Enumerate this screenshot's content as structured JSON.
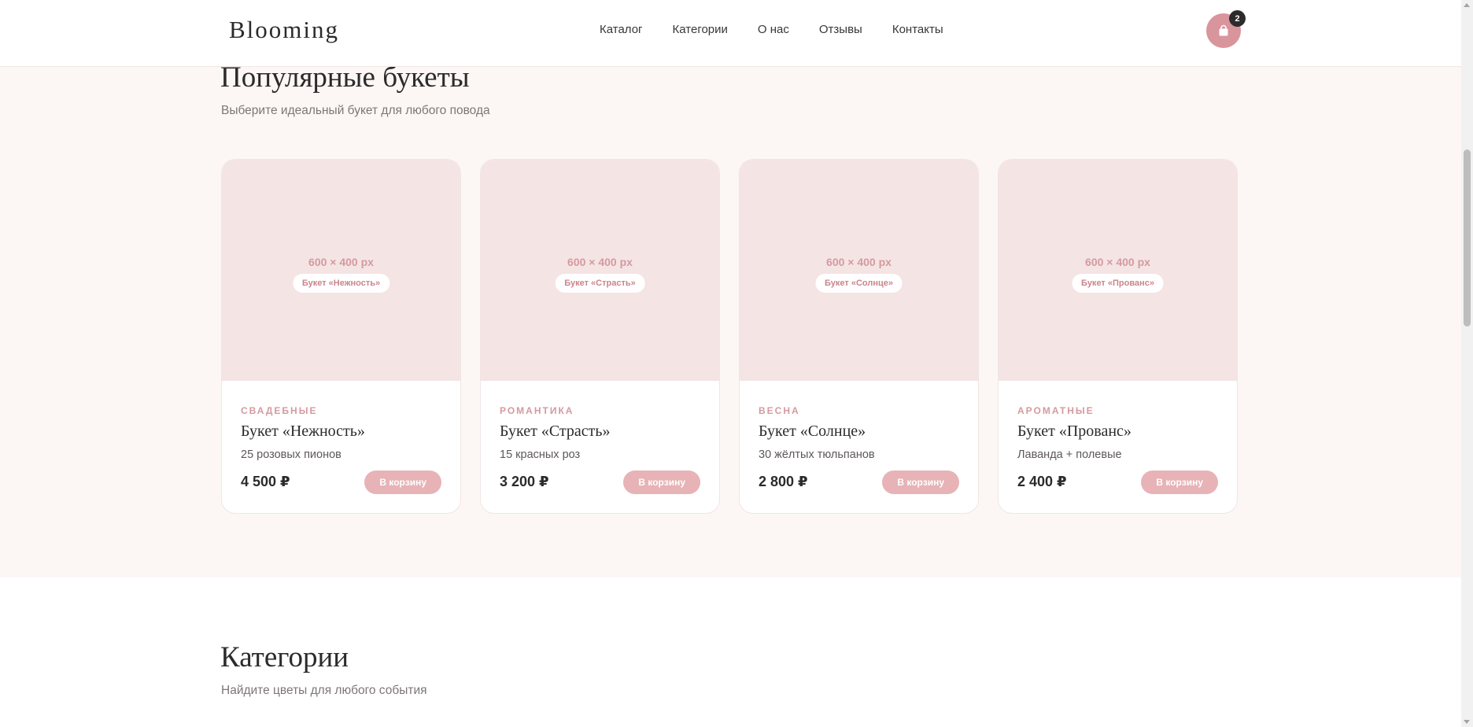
{
  "header": {
    "brand": "Blooming",
    "nav": [
      "Каталог",
      "Категории",
      "О нас",
      "Отзывы",
      "Контакты"
    ],
    "cart_count": "2",
    "cart_icon": "shopping-bag-icon"
  },
  "popular": {
    "title": "Популярные букеты",
    "subtitle": "Выберите идеальный букет для любого повода",
    "products": [
      {
        "image_size": "600 × 400 px",
        "image_label": "Букет «Нежность»",
        "category": "СВАДЕБНЫЕ",
        "title": "Букет «Нежность»",
        "description": "25 розовых пионов",
        "price": "4 500 ₽",
        "button": "В корзину"
      },
      {
        "image_size": "600 × 400 px",
        "image_label": "Букет «Страсть»",
        "category": "РОМАНТИКА",
        "title": "Букет «Страсть»",
        "description": "15 красных роз",
        "price": "3 200 ₽",
        "button": "В корзину"
      },
      {
        "image_size": "600 × 400 px",
        "image_label": "Букет «Солнце»",
        "category": "ВЕСНА",
        "title": "Букет «Солнце»",
        "description": "30 жёлтых тюльпанов",
        "price": "2 800 ₽",
        "button": "В корзину"
      },
      {
        "image_size": "600 × 400 px",
        "image_label": "Букет «Прованс»",
        "category": "АРОМАТНЫЕ",
        "title": "Букет «Прованс»",
        "description": "Лаванда + полевые",
        "price": "2 400 ₽",
        "button": "В корзину"
      }
    ]
  },
  "categories": {
    "title": "Категории",
    "subtitle": "Найдите цветы для любого события"
  },
  "colors": {
    "accent": "#d9959c",
    "button": "#e7b3b6",
    "section_bg": "#fcf7f5",
    "image_placeholder": "#f5e4e4"
  }
}
